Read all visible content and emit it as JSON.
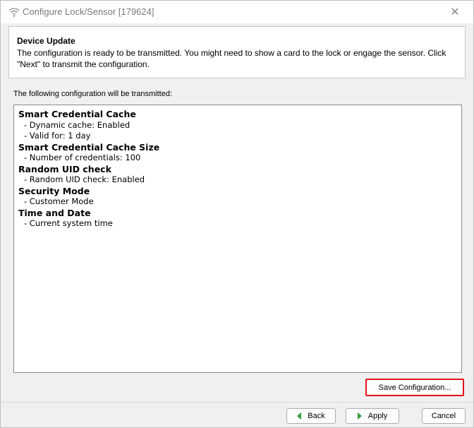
{
  "window": {
    "title": "Configure Lock/Sensor [179624]",
    "title_icon": "wireless-lock-icon",
    "close_glyph": "✕"
  },
  "header": {
    "title": "Device Update",
    "description": "The configuration is ready to be transmitted. You might need to show a card to the lock or engage the sensor. Click \"Next\" to transmit the configuration."
  },
  "intro_label": "The following configuration will be transmitted:",
  "config": {
    "sections": [
      {
        "heading": "Smart Credential Cache",
        "items": [
          "- Dynamic cache: Enabled",
          "- Valid for: 1 day"
        ]
      },
      {
        "heading": "Smart Credential Cache Size",
        "items": [
          "- Number of credentials: 100"
        ]
      },
      {
        "heading": "Random UID check",
        "items": [
          "- Random UID check: Enabled"
        ]
      },
      {
        "heading": "Security Mode",
        "items": [
          "- Customer Mode"
        ]
      },
      {
        "heading": "Time and Date",
        "items": [
          "- Current system time"
        ]
      }
    ]
  },
  "buttons": {
    "save_configuration": "Save Configuration...",
    "back": "Back",
    "apply": "Apply",
    "cancel": "Cancel"
  },
  "colors": {
    "highlight": "#e2141b",
    "arrow": "#2e9e3c"
  }
}
